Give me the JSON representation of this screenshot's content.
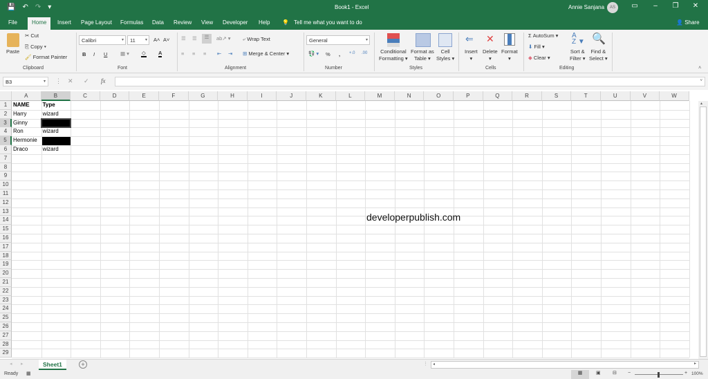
{
  "titlebar": {
    "title": "Book1  -  Excel",
    "user_name": "Annie Sanjana",
    "user_initials": "AS",
    "qat": {
      "save": "💾",
      "undo": "↶",
      "redo": "↷",
      "customize": "▾"
    },
    "window": {
      "ribbon_display": "▭",
      "minimize": "–",
      "restore": "❐",
      "close": "✕"
    }
  },
  "tabs": [
    {
      "label": "File"
    },
    {
      "label": "Home",
      "active": true
    },
    {
      "label": "Insert"
    },
    {
      "label": "Page Layout"
    },
    {
      "label": "Formulas"
    },
    {
      "label": "Data"
    },
    {
      "label": "Review"
    },
    {
      "label": "View"
    },
    {
      "label": "Developer"
    },
    {
      "label": "Help"
    }
  ],
  "tell_me": "Tell me what you want to do",
  "share": "Share",
  "ribbon": {
    "clipboard": {
      "paste": "Paste",
      "cut": "Cut",
      "copy": "Copy",
      "format_painter": "Format Painter",
      "label": "Clipboard"
    },
    "font": {
      "font_name": "Calibri",
      "font_size": "11",
      "bold": "B",
      "italic": "I",
      "underline": "U",
      "grow": "A˄",
      "shrink": "A˅",
      "font_color": "A",
      "label": "Font"
    },
    "alignment": {
      "wrap_text": "Wrap Text",
      "merge_center": "Merge & Center",
      "label": "Alignment"
    },
    "number": {
      "format": "General",
      "percent": "%",
      "comma": ",",
      "inc_dec": "+.0",
      "dec_dec": ".00",
      "label": "Number"
    },
    "styles": {
      "conditional_1": "Conditional",
      "conditional_2": "Formatting ▾",
      "table_1": "Format as",
      "table_2": "Table ▾",
      "cell_1": "Cell",
      "cell_2": "Styles ▾",
      "label": "Styles"
    },
    "cells": {
      "insert": "Insert",
      "delete": "Delete",
      "format": "Format",
      "label": "Cells"
    },
    "editing": {
      "autosum": "AutoSum",
      "fill": "Fill ▾",
      "clear": "Clear ▾",
      "sort_1": "Sort &",
      "sort_2": "Filter ▾",
      "find_1": "Find &",
      "find_2": "Select ▾",
      "label": "Editing"
    }
  },
  "formula_bar": {
    "name_box": "B3",
    "cancel": "✕",
    "enter": "✓",
    "fx": "fx",
    "value": ""
  },
  "columns": [
    "A",
    "B",
    "C",
    "D",
    "E",
    "F",
    "G",
    "H",
    "I",
    "J",
    "K",
    "L",
    "M",
    "N",
    "O",
    "P",
    "Q",
    "R",
    "S",
    "T",
    "U",
    "V",
    "W"
  ],
  "selected_column": "B",
  "selected_cell": "B3",
  "rows_count": 29,
  "cells": [
    {
      "ref": "A1",
      "value": "NAME",
      "bold": true
    },
    {
      "ref": "B1",
      "value": "Type",
      "bold": true
    },
    {
      "ref": "A2",
      "value": "Harry"
    },
    {
      "ref": "B2",
      "value": "wizard"
    },
    {
      "ref": "A3",
      "value": "Ginny"
    },
    {
      "ref": "A4",
      "value": "Ron"
    },
    {
      "ref": "B4",
      "value": "wizard"
    },
    {
      "ref": "A5",
      "value": "Hermonie"
    },
    {
      "ref": "A6",
      "value": "Draco"
    },
    {
      "ref": "B6",
      "value": "wizard"
    }
  ],
  "black_fill_cells": [
    "B3",
    "B5"
  ],
  "watermark": "developerpublish.com",
  "sheets": [
    {
      "name": "Sheet1",
      "active": true
    }
  ],
  "add_sheet": "+",
  "status": {
    "mode": "Ready",
    "zoom": "100%",
    "zoom_minus": "−",
    "zoom_plus": "+"
  },
  "colors": {
    "brand": "#217346"
  }
}
